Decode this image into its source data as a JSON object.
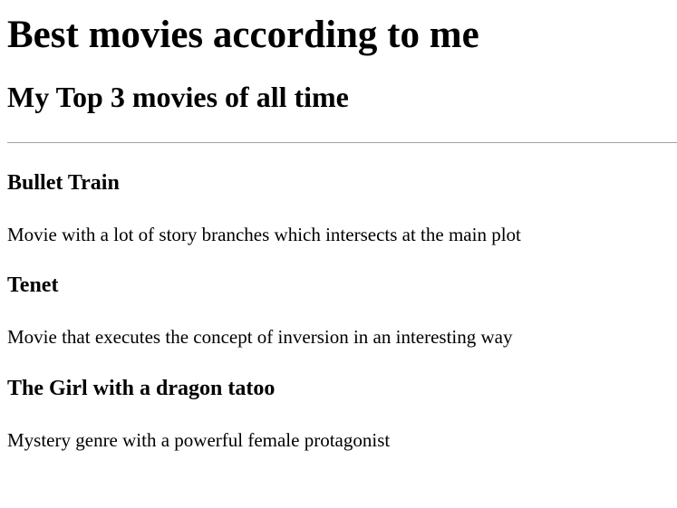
{
  "page": {
    "title": "Best movies according to me",
    "subtitle": "My Top 3 movies of all time"
  },
  "movies": [
    {
      "title": "Bullet Train",
      "description": "Movie with a lot of story branches which intersects at the main plot"
    },
    {
      "title": "Tenet",
      "description": "Movie that executes the concept of inversion in an interesting way"
    },
    {
      "title": "The Girl with a dragon tatoo",
      "description": "Mystery genre with a powerful female protagonist"
    }
  ]
}
